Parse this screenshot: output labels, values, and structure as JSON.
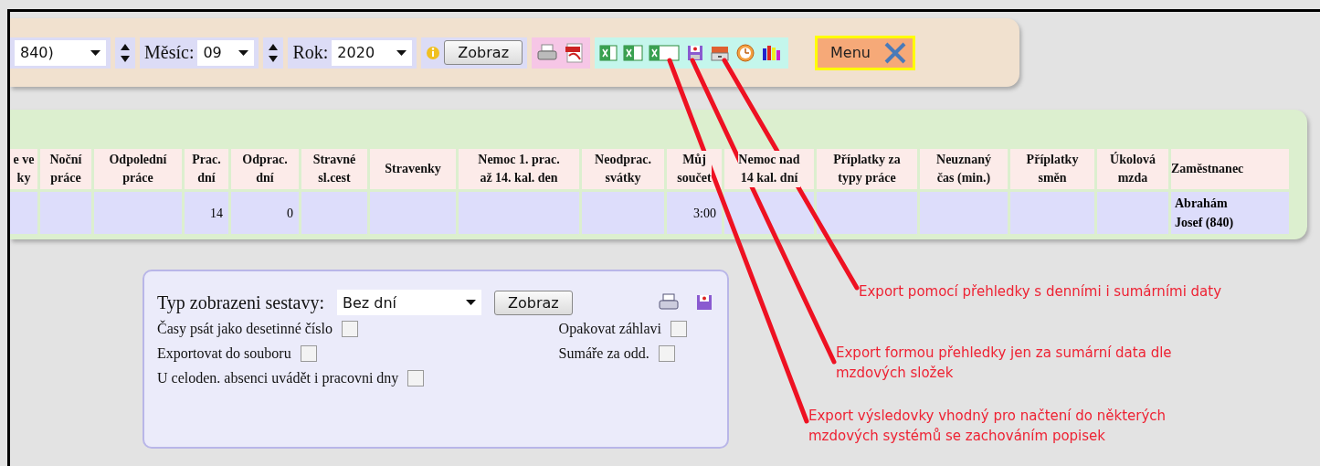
{
  "toolbar": {
    "employee_select": {
      "value": "840)"
    },
    "month": {
      "label": "Měsíc:",
      "value": "09"
    },
    "year": {
      "label": "Rok:",
      "value": "2020"
    },
    "show_button": "Zobraz",
    "menu_button": "Menu"
  },
  "table": {
    "columns": [
      "e ve\nky",
      "Noční\npráce",
      "Odpolední\npráce",
      "Prac.\ndní",
      "Odprac.\ndní",
      "Stravné\nsl.cest",
      "Stravenky",
      "Nemoc 1. prac.\naž 14. kal. den",
      "Neodprac.\nsvátky",
      "Můj\nsoučet",
      "Nemoc nad\n14 kal. dní",
      "Příplatky za\ntypy práce",
      "Neuznaný\nčas (min.)",
      "Příplatky\nsměn",
      "Úkolová\nmzda",
      "Zaměstnanec"
    ],
    "rows": [
      {
        "cells": [
          "",
          "",
          "",
          "14",
          "0",
          "",
          "",
          "",
          "",
          "3:00",
          "",
          "",
          "",
          "",
          "",
          "Abrahám\nJosef (840)"
        ]
      }
    ]
  },
  "report_options": {
    "type_label": "Typ zobrazeni sestavy:",
    "type_select": {
      "value": "Bez dní"
    },
    "show_button": "Zobraz",
    "left_checkboxes": [
      {
        "label": "Časy psát jako desetinné číslo",
        "checked": false
      },
      {
        "label": "Exportovat do souboru",
        "checked": false
      },
      {
        "label": "U celoden. absenci uvádět i pracovni dny",
        "checked": false
      }
    ],
    "right_checkboxes": [
      {
        "label": "Opakovat záhlavi",
        "checked": false
      },
      {
        "label": "Sumáře za odd.",
        "checked": false
      }
    ]
  },
  "annotations": [
    {
      "text": "Export pomocí přehledky s denními i sumárními daty"
    },
    {
      "text": "Export formou přehledky jen za sumární data dle\nmzdových složek"
    },
    {
      "text": "Export výsledovky vhodný pro načtení do některých\nmzdových systémů se zachováním popisek"
    }
  ]
}
